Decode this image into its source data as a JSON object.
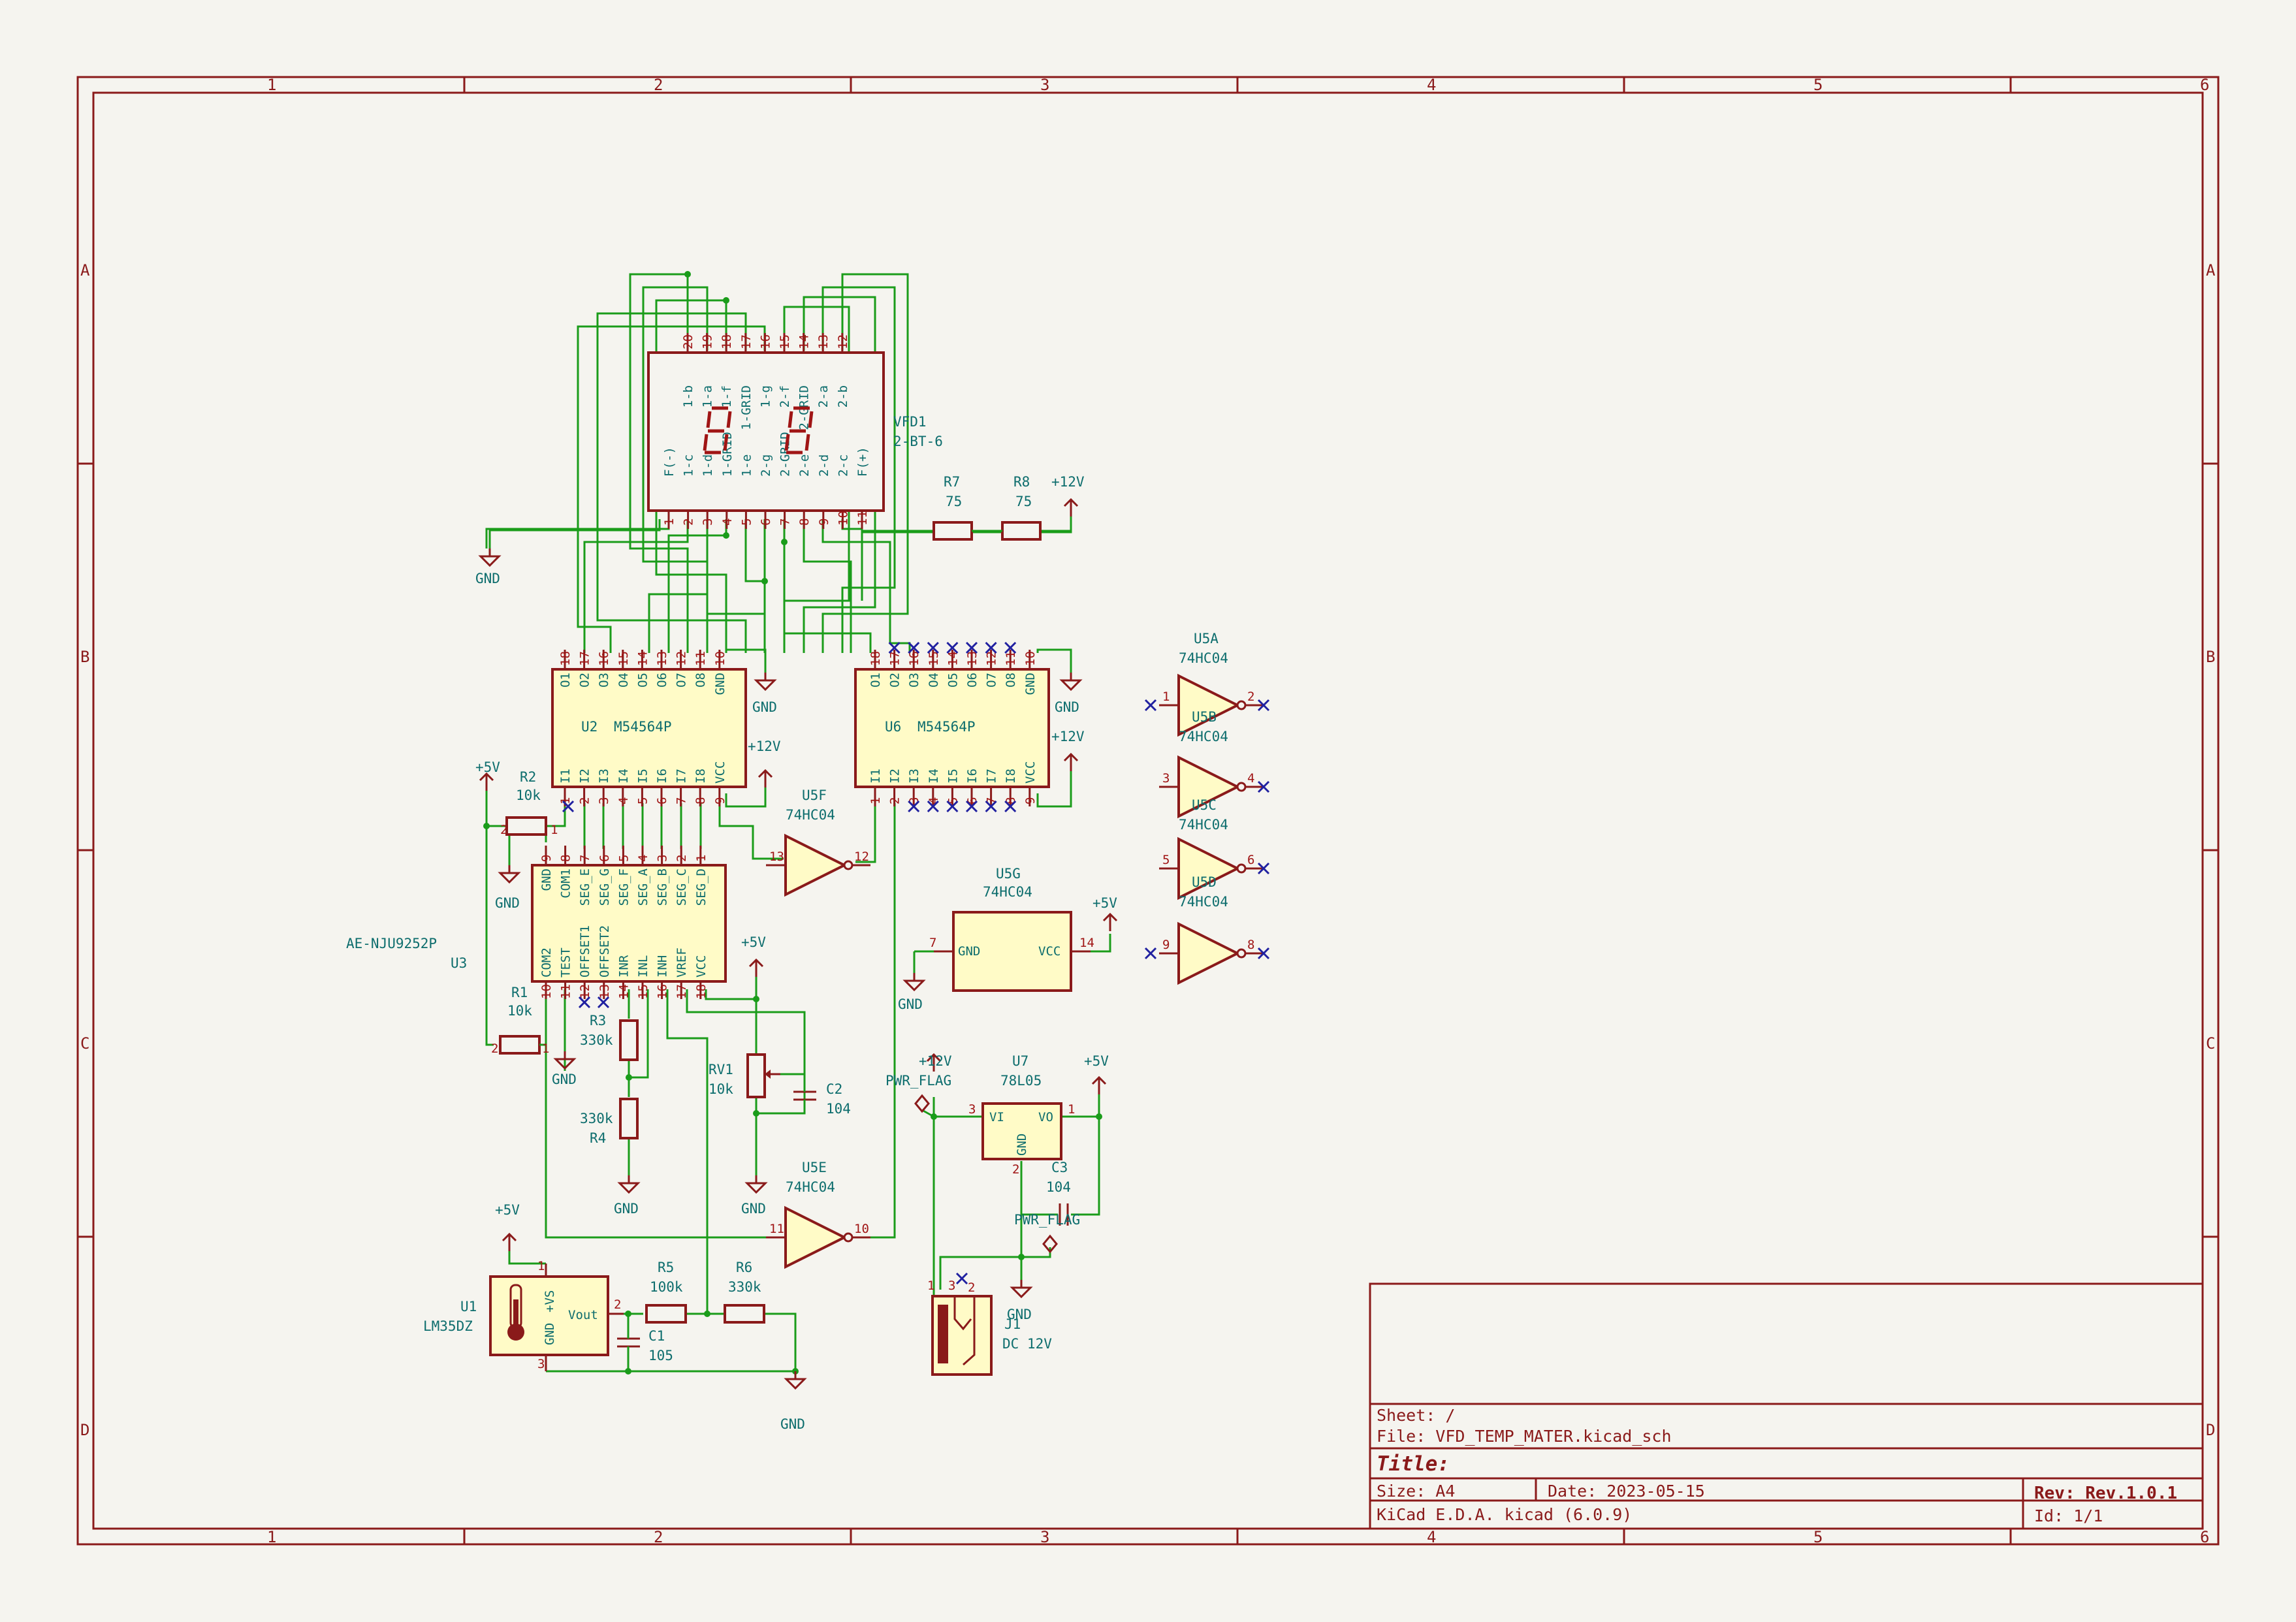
{
  "frame": {
    "columns": [
      "1",
      "2",
      "3",
      "4",
      "5",
      "6"
    ],
    "rows": [
      "A",
      "B",
      "C",
      "D"
    ]
  },
  "title_block": {
    "sheet": "Sheet: /",
    "file": "File: VFD_TEMP_MATER.kicad_sch",
    "title": "Title:",
    "size": "Size: A4",
    "date": "Date: 2023-05-15",
    "rev": "Rev: Rev.1.0.1",
    "tool": "KiCad E.D.A.  kicad (6.0.9)",
    "id": "Id: 1/1"
  },
  "vfd": {
    "ref": "VFD1",
    "value": "2-BT-6",
    "top_pins": [
      {
        "num": "20",
        "name": "1-b"
      },
      {
        "num": "19",
        "name": "1-a"
      },
      {
        "num": "18",
        "name": "1-f"
      },
      {
        "num": "17",
        "name": "1-GRID"
      },
      {
        "num": "16",
        "name": "1-g"
      },
      {
        "num": "15",
        "name": "2-f"
      },
      {
        "num": "14",
        "name": "2-GRID"
      },
      {
        "num": "13",
        "name": "2-a"
      },
      {
        "num": "12",
        "name": "2-b"
      }
    ],
    "bottom_pins": [
      {
        "num": "1",
        "name": "F(-)"
      },
      {
        "num": "2",
        "name": "1-c"
      },
      {
        "num": "3",
        "name": "1-d"
      },
      {
        "num": "4",
        "name": "1-GRID"
      },
      {
        "num": "5",
        "name": "1-e"
      },
      {
        "num": "6",
        "name": "2-g"
      },
      {
        "num": "7",
        "name": "2-GRID"
      },
      {
        "num": "8",
        "name": "2-e"
      },
      {
        "num": "9",
        "name": "2-d"
      },
      {
        "num": "10",
        "name": "2-c"
      },
      {
        "num": "11",
        "name": "F(+)"
      }
    ]
  },
  "u2": {
    "ref": "U2",
    "value": "M54564P",
    "top_pins": [
      {
        "num": "18",
        "name": "O1"
      },
      {
        "num": "17",
        "name": "O2"
      },
      {
        "num": "16",
        "name": "O3"
      },
      {
        "num": "15",
        "name": "O4"
      },
      {
        "num": "14",
        "name": "O5"
      },
      {
        "num": "13",
        "name": "O6"
      },
      {
        "num": "12",
        "name": "O7"
      },
      {
        "num": "11",
        "name": "O8"
      },
      {
        "num": "10",
        "name": "GND"
      }
    ],
    "bottom_pins": [
      {
        "num": "1",
        "name": "I1"
      },
      {
        "num": "2",
        "name": "I2"
      },
      {
        "num": "3",
        "name": "I3"
      },
      {
        "num": "4",
        "name": "I4"
      },
      {
        "num": "5",
        "name": "I5"
      },
      {
        "num": "6",
        "name": "I6"
      },
      {
        "num": "7",
        "name": "I7"
      },
      {
        "num": "8",
        "name": "I8"
      },
      {
        "num": "9",
        "name": "VCC"
      }
    ]
  },
  "u6": {
    "ref": "U6",
    "value": "M54564P",
    "top_pins": [
      {
        "num": "18",
        "name": "O1"
      },
      {
        "num": "17",
        "name": "O2"
      },
      {
        "num": "16",
        "name": "O3"
      },
      {
        "num": "15",
        "name": "O4"
      },
      {
        "num": "14",
        "name": "O5"
      },
      {
        "num": "13",
        "name": "O6"
      },
      {
        "num": "12",
        "name": "O7"
      },
      {
        "num": "11",
        "name": "O8"
      },
      {
        "num": "10",
        "name": "GND"
      }
    ],
    "bottom_pins": [
      {
        "num": "1",
        "name": "I1"
      },
      {
        "num": "2",
        "name": "I2"
      },
      {
        "num": "3",
        "name": "I3"
      },
      {
        "num": "4",
        "name": "I4"
      },
      {
        "num": "5",
        "name": "I5"
      },
      {
        "num": "6",
        "name": "I6"
      },
      {
        "num": "7",
        "name": "I7"
      },
      {
        "num": "8",
        "name": "I8"
      },
      {
        "num": "9",
        "name": "VCC"
      }
    ]
  },
  "u3": {
    "ref": "U3",
    "value": "AE-NJU9252P",
    "top_pins": [
      {
        "num": "9",
        "name": "GND"
      },
      {
        "num": "8",
        "name": "COM1"
      },
      {
        "num": "7",
        "name": "SEG_E"
      },
      {
        "num": "6",
        "name": "SEG_G"
      },
      {
        "num": "5",
        "name": "SEG_F"
      },
      {
        "num": "4",
        "name": "SEG_A"
      },
      {
        "num": "3",
        "name": "SEG_B"
      },
      {
        "num": "2",
        "name": "SEG_C"
      },
      {
        "num": "1",
        "name": "SEG_D"
      }
    ],
    "bottom_pins": [
      {
        "num": "10",
        "name": "COM2"
      },
      {
        "num": "11",
        "name": "TEST"
      },
      {
        "num": "12",
        "name": "OFFSET1"
      },
      {
        "num": "13",
        "name": "OFFSET2"
      },
      {
        "num": "14",
        "name": "INR"
      },
      {
        "num": "15",
        "name": "INL"
      },
      {
        "num": "16",
        "name": "INH"
      },
      {
        "num": "17",
        "name": "VREF"
      },
      {
        "num": "18",
        "name": "VCC"
      }
    ]
  },
  "u1": {
    "ref": "U1",
    "value": "LM35DZ",
    "pin_vs": "+VS",
    "pin_gnd": "GND",
    "pin_out": "Vout",
    "n1": "1",
    "n2": "2",
    "n3": "3"
  },
  "u7": {
    "ref": "U7",
    "value": "78L05",
    "vi": "VI",
    "vo": "VO",
    "gnd": "GND",
    "n1": "1",
    "n2": "2",
    "n3": "3"
  },
  "j1": {
    "ref": "J1",
    "value": "DC 12V",
    "n1": "1",
    "n2": "2",
    "n3": "3"
  },
  "u5g": {
    "ref": "U5G",
    "value": "74HC04",
    "gnd": "GND",
    "vcc": "VCC",
    "n_gnd": "7",
    "n_vcc": "14"
  },
  "inverters": [
    {
      "ref": "U5A",
      "value": "74HC04",
      "in": "1",
      "out": "2"
    },
    {
      "ref": "U5B",
      "value": "74HC04",
      "in": "3",
      "out": "4"
    },
    {
      "ref": "U5C",
      "value": "74HC04",
      "in": "5",
      "out": "6"
    },
    {
      "ref": "U5D",
      "value": "74HC04",
      "in": "9",
      "out": "8"
    },
    {
      "ref": "U5F",
      "value": "74HC04",
      "in": "13",
      "out": "12"
    },
    {
      "ref": "U5E",
      "value": "74HC04",
      "in": "11",
      "out": "10"
    }
  ],
  "passives": {
    "r1": {
      "ref": "R1",
      "value": "10k"
    },
    "r2": {
      "ref": "R2",
      "value": "10k"
    },
    "r3": {
      "ref": "R3",
      "value": "330k"
    },
    "r4": {
      "ref": "R4",
      "value": "330k"
    },
    "r5": {
      "ref": "R5",
      "value": "100k"
    },
    "r6": {
      "ref": "R6",
      "value": "330k"
    },
    "r7": {
      "ref": "R7",
      "value": "75"
    },
    "r8": {
      "ref": "R8",
      "value": "75"
    },
    "rv1": {
      "ref": "RV1",
      "value": "10k"
    },
    "c1": {
      "ref": "C1",
      "value": "105"
    },
    "c2": {
      "ref": "C2",
      "value": "104"
    },
    "c3": {
      "ref": "C3",
      "value": "104"
    }
  },
  "nets": {
    "gnd": "GND",
    "p5": "+5V",
    "p12": "+12V",
    "pwr_flag": "PWR_FLAG"
  },
  "colors": {
    "frame": "#8a1a1a",
    "wire": "#1a9c1a",
    "body_fill": "#fffbc7",
    "text": "#0d6d6d",
    "nc": "#2020a0",
    "background": "#f5f4ef"
  }
}
